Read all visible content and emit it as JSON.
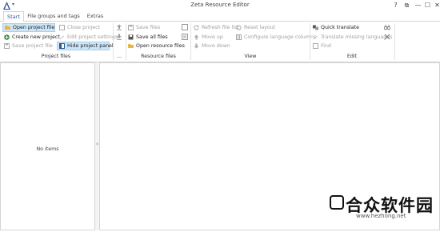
{
  "window": {
    "title": "Zeta Resource Editor",
    "controls": [
      "?",
      "⧉",
      "—",
      "☐",
      "✕"
    ]
  },
  "tabs": [
    {
      "label": "Start",
      "active": true
    },
    {
      "label": "File groups and tags",
      "active": false
    },
    {
      "label": "Extras",
      "active": false
    }
  ],
  "ribbon": {
    "project_files": {
      "label": "Project files",
      "open_project_file": "Open project file",
      "create_new_project": "Create new project",
      "save_project_file": "Save project file",
      "close_project": "Close project",
      "edit_project_settings": "Edit project settings",
      "hide_project_panel": "Hide project panel"
    },
    "small_group": {
      "label": "..."
    },
    "resource_files": {
      "label": "Resource files",
      "save_files": "Save files",
      "save_all_files": "Save all files",
      "open_resource_files": "Open resource files"
    },
    "view": {
      "label": "View",
      "refresh_file_list": "Refresh file list",
      "move_up": "Move up",
      "move_down": "Move down",
      "reset_layout": "Reset layout",
      "configure_language_columns": "Configure language columns"
    },
    "edit": {
      "label": "Edit",
      "quick_translate": "Quick translate",
      "translate_missing_languages": "Translate missing languages",
      "find": "Find"
    }
  },
  "left_panel": {
    "empty_text": "No items"
  },
  "watermark": {
    "text": "合众软件园",
    "url": "www.hezhong.net"
  },
  "colors": {
    "accent": "#2b5797",
    "active_bg": "#cde6f7",
    "border": "#d4d4d4"
  }
}
